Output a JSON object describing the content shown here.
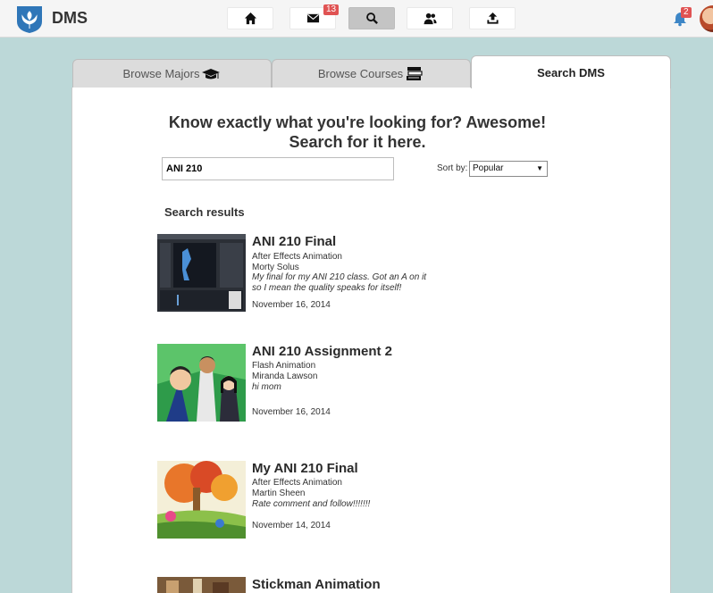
{
  "app": {
    "brand": "DMS"
  },
  "nav": {
    "mail_badge": "13",
    "bell_badge": "2"
  },
  "tabs": [
    {
      "label": "Browse Majors"
    },
    {
      "label": "Browse Courses"
    },
    {
      "label": "Search DMS"
    }
  ],
  "search": {
    "heading_line1": "Know exactly what you're looking for? Awesome!",
    "heading_line2": "Search for it here.",
    "query": "ANI 210",
    "sort_label": "Sort by:",
    "sort_value": "Popular",
    "results_label": "Search results"
  },
  "results": [
    {
      "title": "ANI 210 Final",
      "course": "After Effects Animation",
      "author": "Morty Solus",
      "description": "My final for my ANI 210 class. Got an A on it so I mean the quality speaks for itself!",
      "date": "November 16, 2014"
    },
    {
      "title": "ANI 210 Assignment 2",
      "course": "Flash Animation",
      "author": "Miranda Lawson",
      "description": "hi mom",
      "date": "November 16, 2014"
    },
    {
      "title": "My ANI 210 Final",
      "course": "After Effects Animation",
      "author": "Martin Sheen",
      "description": "Rate comment and follow!!!!!!!",
      "date": "November 14, 2014"
    },
    {
      "title": "Stickman Animation"
    }
  ],
  "colors": {
    "background": "#bcd8d8",
    "badge": "#e05353",
    "logo": "#2f76b8"
  }
}
